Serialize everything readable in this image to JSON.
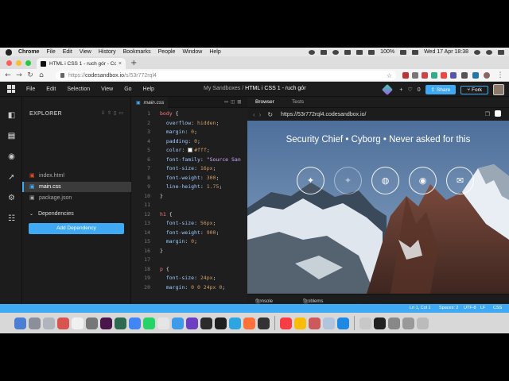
{
  "menubar": {
    "app": "Chrome",
    "items": [
      "File",
      "Edit",
      "View",
      "History",
      "Bookmarks",
      "People",
      "Window",
      "Help"
    ],
    "battery": "100%",
    "clock": "Wed 17 Apr  18:38"
  },
  "browser_tab": {
    "title": "HTML i CSS 1 - ruch gór - Cod",
    "close": "×",
    "new_tab": "+"
  },
  "address_bar": {
    "scheme": "https://",
    "host": "codesandbox.io",
    "path": "/s/53r772rql4",
    "star": "☆"
  },
  "cs_header": {
    "menus": [
      "File",
      "Edit",
      "Selection",
      "View",
      "Go",
      "Help"
    ],
    "breadcrumb_prefix": "My Sandboxes /",
    "sandbox_name": "HTML i CSS 1 - ruch gór",
    "plus": "+",
    "likes": "0",
    "share_label": "Share",
    "fork_label": "Fork"
  },
  "explorer": {
    "title": "EXPLORER",
    "files": [
      {
        "name": "index.html",
        "icon": "html-file-icon",
        "color": "#e44d26"
      },
      {
        "name": "main.css",
        "icon": "css-file-icon",
        "color": "#40a9f3"
      },
      {
        "name": "package.json",
        "icon": "json-file-icon",
        "color": "#aaaaaa"
      }
    ],
    "dependencies_label": "Dependencies",
    "add_dependency_label": "Add Dependency",
    "build_id": "PROD-1555236679-ca6466496"
  },
  "editor": {
    "tab_label": "main.css",
    "line_numbers": [
      "1",
      "2",
      "3",
      "4",
      "5",
      "6",
      "7",
      "8",
      "9",
      "10",
      "11",
      "12",
      "13",
      "14",
      "15",
      "16",
      "17",
      "18",
      "19",
      "20"
    ],
    "lines": [
      {
        "sel": "body",
        "rest": " {"
      },
      {
        "prop": "overflow",
        "val": "hidden"
      },
      {
        "prop": "margin",
        "val": "0"
      },
      {
        "prop": "padding",
        "val": "0"
      },
      {
        "prop": "color",
        "val": "#fff",
        "swatch": true
      },
      {
        "prop": "font-family",
        "val": "\"Source San"
      },
      {
        "prop": "font-size",
        "val": "16px"
      },
      {
        "prop": "font-weight",
        "val": "300"
      },
      {
        "prop": "line-height",
        "val": "1.75"
      },
      {
        "raw": "}"
      },
      {
        "raw": ""
      },
      {
        "sel": "h1",
        "rest": " {"
      },
      {
        "prop": "font-size",
        "val": "56px"
      },
      {
        "prop": "font-weight",
        "val": "900"
      },
      {
        "prop": "margin",
        "val": "0"
      },
      {
        "raw": "}"
      },
      {
        "raw": ""
      },
      {
        "sel": "p",
        "rest": " {"
      },
      {
        "prop": "font-size",
        "val": "24px"
      },
      {
        "prop": "margin",
        "val": "0 0 24px 0"
      }
    ]
  },
  "browser_panel": {
    "tabs": [
      "Browser",
      "Tests"
    ],
    "url": "https://53r772rql4.codesandbox.io/",
    "tagline": "Security Chief  •  Cyborg  •  Never asked for this",
    "social_icons": [
      "twitter-icon",
      "twitter-icon",
      "dribbble-icon",
      "github-icon",
      "mail-icon"
    ],
    "console_label": "Console",
    "console_count": "0",
    "problems_label": "Problems",
    "problems_count": "0"
  },
  "statusbar": {
    "position": "Ln 1, Col 1",
    "spaces": "Spaces: 2",
    "encoding": "UTF-8",
    "eol": "LF",
    "language": "CSS"
  },
  "colors": {
    "accent": "#40a9f3",
    "background": "#1c1c1c"
  }
}
